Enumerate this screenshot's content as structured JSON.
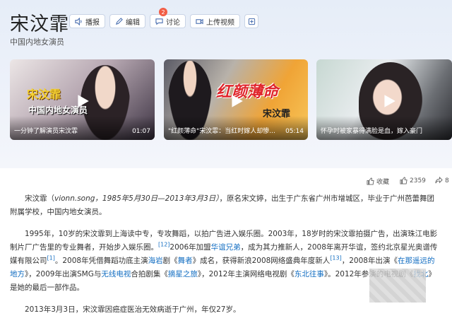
{
  "title": "宋汶霏",
  "subtitle": "中国内地女演员",
  "actions": [
    {
      "label": "播报",
      "icon": "speaker-icon"
    },
    {
      "label": "编辑",
      "icon": "pencil-icon"
    },
    {
      "label": "讨论",
      "icon": "chat-icon",
      "badge": "2"
    },
    {
      "label": "上传视频",
      "icon": "video-upload-icon"
    }
  ],
  "videos": [
    {
      "title": "一分钟了解演员宋汶霏",
      "duration": "01:07",
      "overlay_name": "宋汶霏",
      "overlay_sub": "中国内地女演员"
    },
    {
      "title": "\"红颜薄命\"宋汶霏：当红时嫁人却惨...",
      "duration": "05:14",
      "overlay_main": "红颜薄命",
      "overlay_name": "宋汶霏"
    },
    {
      "title": "怀孕时被家暴得满脸是血，嫁入豪门"
    }
  ],
  "stats": {
    "favorite_label": "收藏",
    "likes": "2359",
    "shares": "8"
  },
  "paragraphs": {
    "p1": {
      "a": "宋汶霏（",
      "en": "vionn.song",
      "b": "，1985年5月30日—2013年3月3日）",
      "c": "，原名宋文婷，出生于广东省广州市增城区，毕业于广州芭蕾舞团附属学校，中国内地女演员。"
    },
    "p2": {
      "t1": "1995年，10岁的宋汶霏到上海读中专，专攻舞蹈，以拍广告进入娱乐圈。2003年，18岁时的宋汶霏拍摄广告，出演珠江电影制片厂广告里的专业舞者，开始步入娱乐圈。",
      "sup1": "[12]",
      "t2": "2006年加盟",
      "l1": "华谊兄弟",
      "t3": "，成为其力推新人，2008年离开华谊，签约北京星光奥谱传媒有限公司",
      "sup2": "[1]",
      "t4": "。2008年凭借舞蹈功底主演",
      "l2": "海岩",
      "t5": "剧《",
      "l3": "舞者",
      "t6": "》成名，获得新浪2008网络盛典年度新人",
      "sup3": "[13]",
      "t7": "，2008年出演《",
      "l4": "在那遥远的地方",
      "t8": "》，2009年出演SMG与",
      "l5": "无线电视",
      "t9": "合拍剧集《",
      "l6": "摘星之旅",
      "t10": "》，2012年主演网络电视剧《",
      "l7": "东北往事",
      "t11": "》。2012年参演的电视剧《",
      "l8": "找北",
      "t12": "》是她的最后一部作品。"
    },
    "p3": "2013年3月3日，宋汶霏因癌症医治无效病逝于广州，年仅27岁。"
  },
  "colors": {
    "link": "#136ec2",
    "badge": "#f25d45",
    "overlay_yellow": "#f6d233",
    "overlay_red": "#e0252b"
  }
}
